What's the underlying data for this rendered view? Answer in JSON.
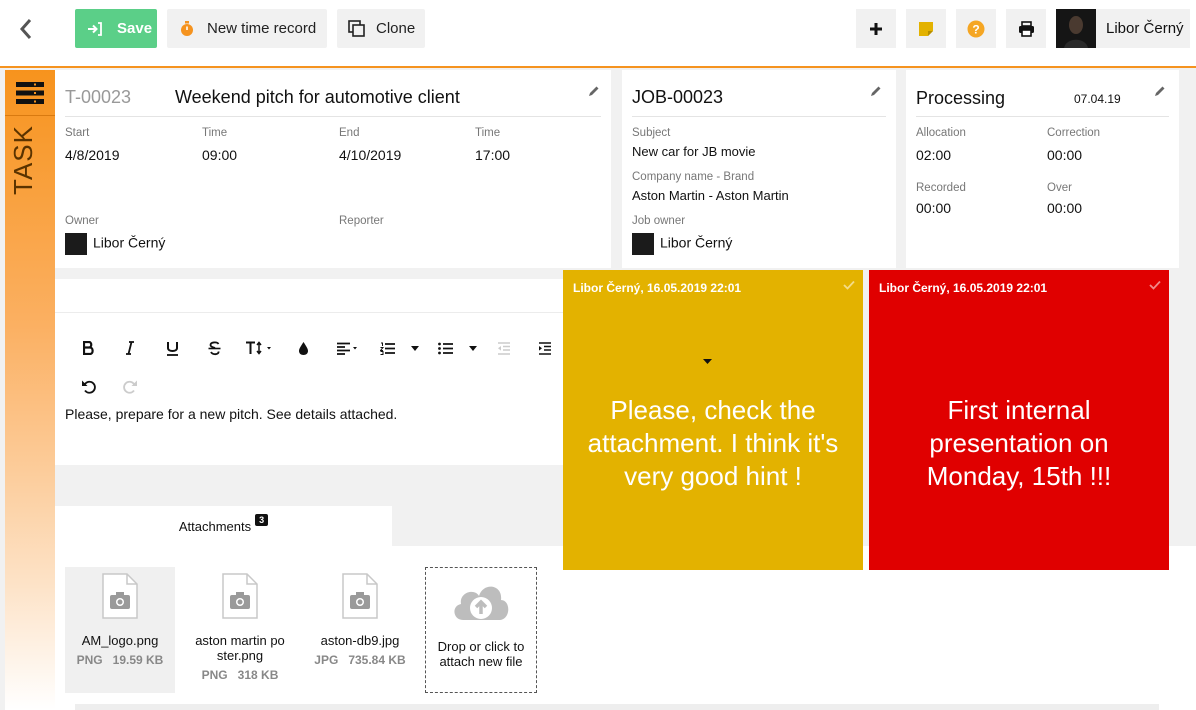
{
  "toolbar": {
    "save_label": "Save",
    "new_time_label": "New time record",
    "clone_label": "Clone",
    "user_name": "Libor Černý",
    "accent_color": "#f5931f",
    "save_color": "#5bcf88"
  },
  "side": {
    "label": "TASK"
  },
  "task": {
    "id": "T-00023",
    "title": "Weekend pitch for automotive client",
    "start_label": "Start",
    "start_value": "4/8/2019",
    "start_time_label": "Time",
    "start_time_value": "09:00",
    "end_label": "End",
    "end_value": "4/10/2019",
    "end_time_label": "Time",
    "end_time_value": "17:00",
    "owner_label": "Owner",
    "owner_value": "Libor Černý",
    "reporter_label": "Reporter"
  },
  "job": {
    "id": "JOB-00023",
    "subject_label": "Subject",
    "subject_value": "New car for JB movie",
    "company_label": "Company name - Brand",
    "company_value": "Aston Martin - Aston Martin",
    "owner_label": "Job owner",
    "owner_value": "Libor Černý"
  },
  "status": {
    "state": "Processing",
    "date": "07.04.19",
    "allocation_label": "Allocation",
    "allocation_value": "02:00",
    "correction_label": "Correction",
    "correction_value": "00:00",
    "recorded_label": "Recorded",
    "recorded_value": "00:00",
    "over_label": "Over",
    "over_value": "00:00"
  },
  "editor": {
    "content": "Please, prepare for a new pitch. See details attached."
  },
  "attachments": {
    "tab_label": "Attachments",
    "count": "3",
    "files": [
      {
        "name": "AM_logo.png",
        "type": "PNG",
        "size": "19.59 KB"
      },
      {
        "name": "aston martin po ster.png",
        "type": "PNG",
        "size": "318 KB"
      },
      {
        "name": "aston-db9.jpg",
        "type": "JPG",
        "size": "735.84 KB"
      }
    ],
    "drop_label": "Drop or click to attach new file"
  },
  "notes": [
    {
      "header": "Libor Černý, 16.05.2019 22:01",
      "text": "Please, check the attachment. I think it's very good hint !",
      "color": "#e3b200"
    },
    {
      "header": "Libor Černý, 16.05.2019 22:01",
      "text": "First internal presentation on Monday, 15th !!!",
      "color": "#e00000"
    }
  ]
}
